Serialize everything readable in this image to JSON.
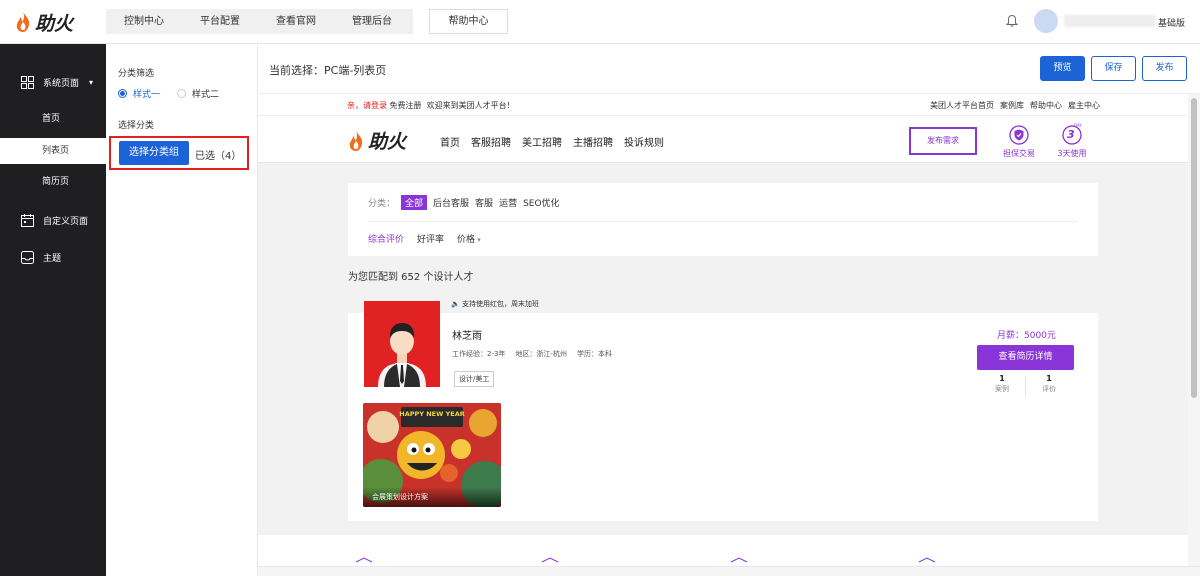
{
  "app": {
    "logo_text": "助火",
    "brand_color": "#1d63d8",
    "accent_color": "#8a35d8",
    "edition": "基础版"
  },
  "topnav": {
    "items": [
      "控制中心",
      "平台配置",
      "查看官网",
      "管理后台"
    ],
    "help": "帮助中心"
  },
  "user": {
    "name": "████████████"
  },
  "sidebar": {
    "group1": {
      "label": "系统页面",
      "icon": "grid-icon"
    },
    "subitems": [
      "首页",
      "列表页",
      "简历页"
    ],
    "active_sub": "列表页",
    "group2": {
      "label": "自定义页面",
      "icon": "calendar-icon"
    },
    "group3": {
      "label": "主题",
      "icon": "inbox-icon"
    }
  },
  "panel": {
    "filter_title": "分类筛选",
    "style_options": [
      "样式一",
      "样式二"
    ],
    "selected_style": "样式一",
    "category_title": "选择分类",
    "select_button": "选择分类组",
    "selected_count": "已选（4）"
  },
  "header": {
    "current": "当前选择：PC端-列表页",
    "preview": "预览",
    "save": "保存",
    "publish": "发布"
  },
  "preview": {
    "topbar_login": "亲，请登录",
    "topbar_rest": "免费注册  欢迎来到美团人才平台！",
    "topbar_links": [
      "美团人才平台首页",
      "案例库",
      "帮助中心",
      "雇主中心"
    ],
    "logo_text": "助火",
    "menu": [
      "首页",
      "客服招聘",
      "美工招聘",
      "主播招聘",
      "投诉规则"
    ],
    "post_button": "发布需求",
    "badge1": "担保交易",
    "badge2": "3天使用",
    "badge2_num": "3",
    "badge2_small": "DAY",
    "filter_label": "分类：",
    "filter_items": [
      "全部",
      "后台客服",
      "客服",
      "运营",
      "SEO优化"
    ],
    "sort_items": [
      "综合评价",
      "好评率",
      "价格"
    ],
    "match_text": "为您匹配到 652 个设计人才",
    "card": {
      "promo": "支持使用红包，周末加班",
      "name": "林芝雨",
      "experience": "工作经验：2-3年",
      "region": "地区：浙江-杭州",
      "education": "学历：本科",
      "tag": "设计/美工",
      "salary": "月薪：5000元",
      "view_button": "查看简历详情",
      "stat1_num": "1",
      "stat1_label": "案例",
      "stat2_num": "1",
      "stat2_label": "评价",
      "work_banner": "HAPPY NEW YEAR",
      "work_label": "会展策划设计方案"
    }
  }
}
